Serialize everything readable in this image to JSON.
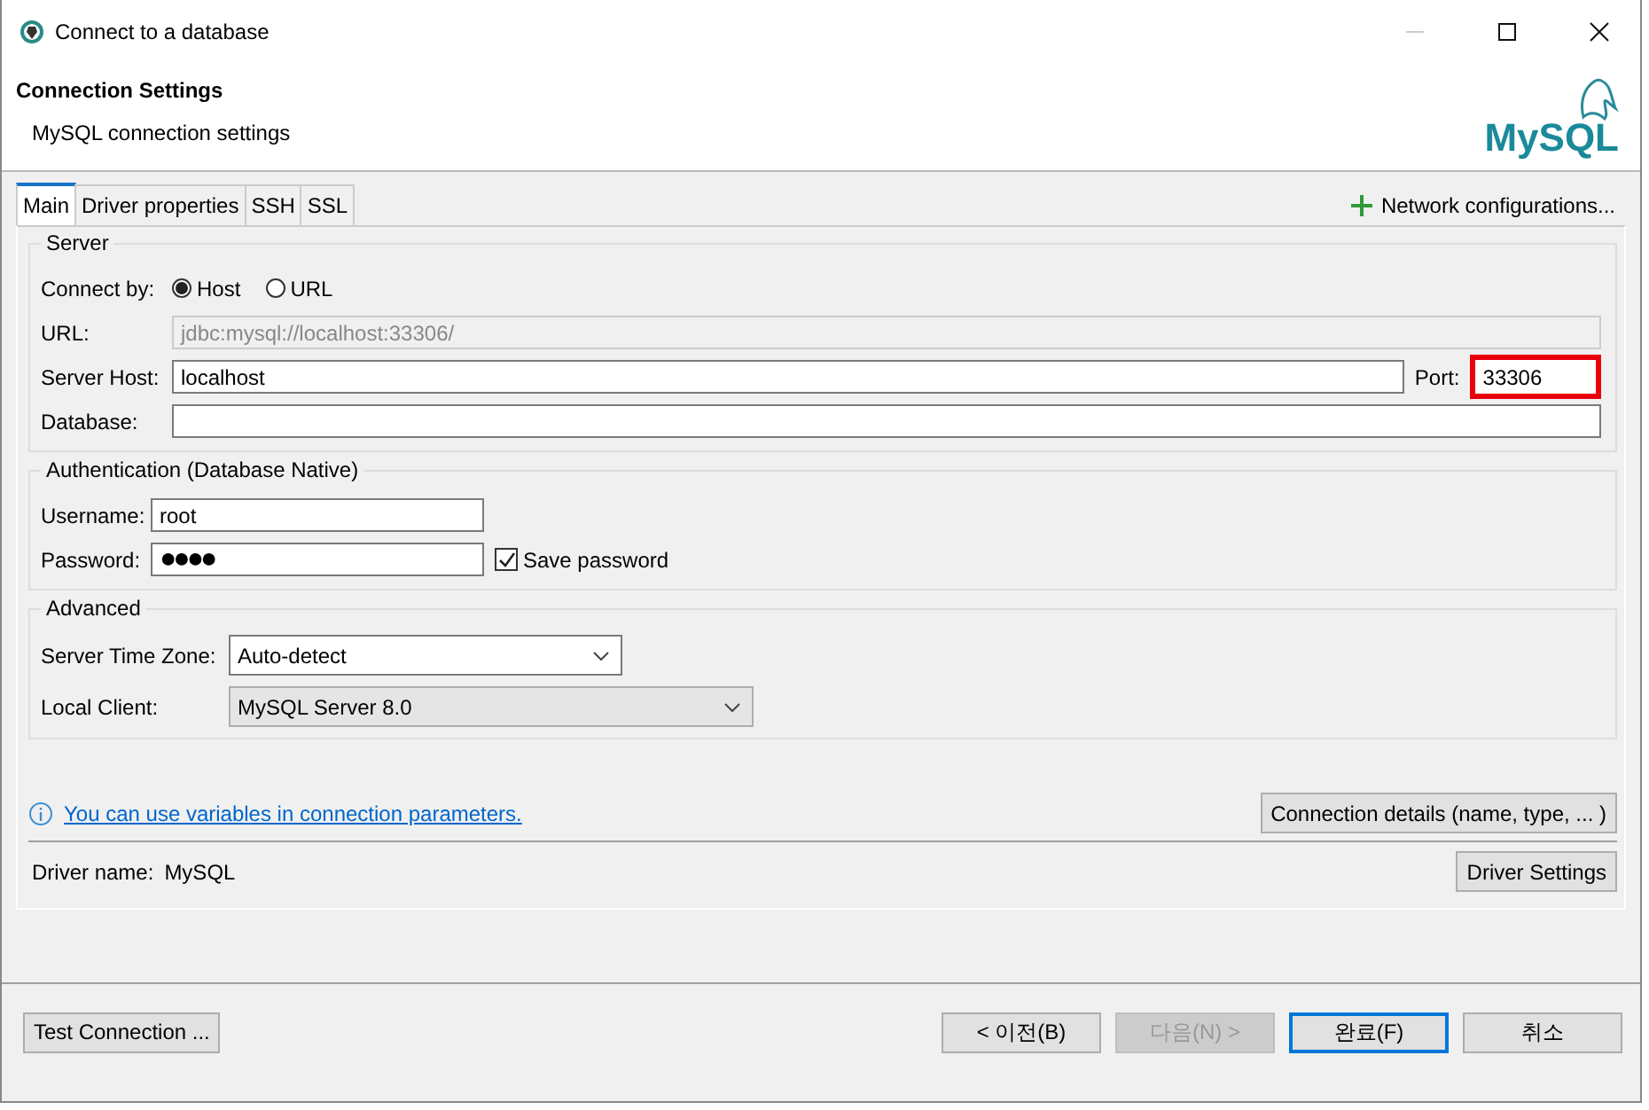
{
  "window": {
    "title": "Connect to a database"
  },
  "header": {
    "title": "Connection Settings",
    "subtitle": "MySQL connection settings",
    "logo": "MySQL"
  },
  "tabs": [
    {
      "label": "Main",
      "selected": true
    },
    {
      "label": "Driver properties",
      "selected": false
    },
    {
      "label": "SSH",
      "selected": false
    },
    {
      "label": "SSL",
      "selected": false
    }
  ],
  "network_configurations": {
    "label": "Network configurations..."
  },
  "server": {
    "legend": "Server",
    "connect_by": {
      "label": "Connect by:",
      "options": [
        {
          "label": "Host",
          "selected": true
        },
        {
          "label": "URL",
          "selected": false
        }
      ]
    },
    "url": {
      "label": "URL:",
      "value": "jdbc:mysql://localhost:33306/",
      "disabled": true
    },
    "host": {
      "label": "Server Host:",
      "value": "localhost"
    },
    "port": {
      "label": "Port:",
      "value": "33306",
      "highlighted": true
    },
    "database": {
      "label": "Database:"
    }
  },
  "authentication": {
    "legend": "Authentication (Database Native)",
    "username": {
      "label": "Username:",
      "value": "root"
    },
    "password": {
      "label": "Password:",
      "value": "●●●●"
    },
    "save_password": {
      "label": "Save password",
      "checked": true
    }
  },
  "advanced": {
    "legend": "Advanced",
    "time_zone": {
      "label": "Server Time Zone:",
      "value": "Auto-detect",
      "disabled": false
    },
    "local_client": {
      "label": "Local Client:",
      "value": "MySQL Server 8.0",
      "disabled": true
    }
  },
  "info_link": "You can use variables in connection parameters.",
  "connection_details_button": "Connection details (name, type, ... )",
  "driver": {
    "label": "Driver name:",
    "value": "MySQL",
    "settings_button": "Driver Settings"
  },
  "footer": {
    "test_button": "Test Connection ...",
    "buttons": [
      {
        "label": "< 이전(B)",
        "disabled": false,
        "default": false
      },
      {
        "label": "다음(N) >",
        "disabled": true,
        "default": false
      },
      {
        "label": "완료(F)",
        "disabled": false,
        "default": true
      },
      {
        "label": "취소",
        "disabled": false,
        "default": false
      }
    ]
  }
}
